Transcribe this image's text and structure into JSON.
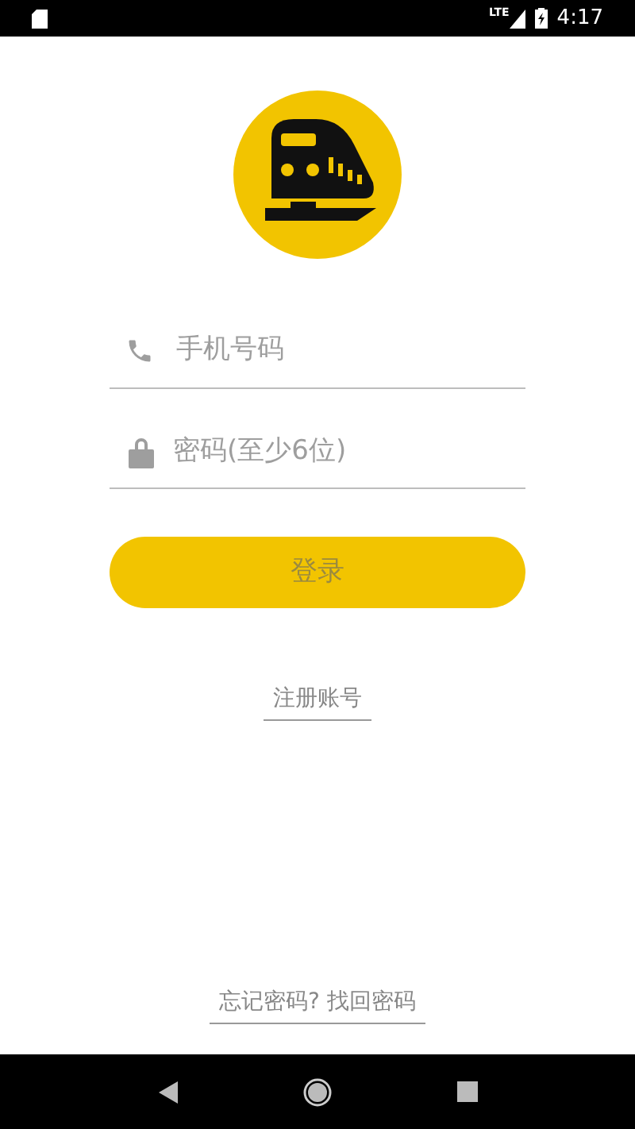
{
  "status_bar": {
    "network": "LTE",
    "time": "4:17"
  },
  "form": {
    "phone": {
      "placeholder": "手机号码"
    },
    "password": {
      "placeholder": "密码(至少6位)"
    },
    "login_button": "登录",
    "register_link": "注册账号",
    "forgot_link": "忘记密码? 找回密码"
  }
}
